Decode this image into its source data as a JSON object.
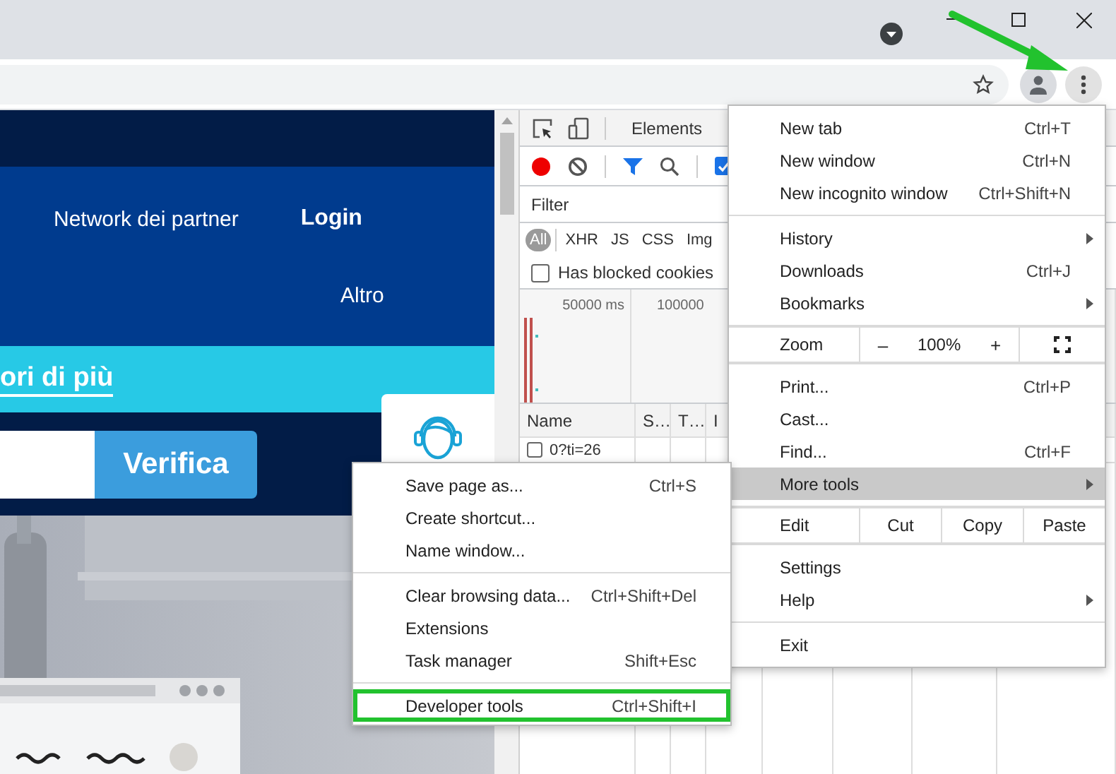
{
  "browser": {
    "menu_open": true
  },
  "page": {
    "nav": [
      {
        "label": "Network dei partner",
        "bold": false
      },
      {
        "label": "Login",
        "bold": true
      }
    ],
    "more_link": "Altro",
    "banner_link": "ori di più",
    "verify_button": "Verifica"
  },
  "devtools": {
    "tabs": [
      {
        "label": "Elements",
        "selected": false
      }
    ],
    "recording": true,
    "preserve_log": true,
    "filter": {
      "placeholder": "Filter"
    },
    "type_filters": [
      {
        "label": "All",
        "selected": true
      },
      {
        "label": "XHR",
        "selected": false
      },
      {
        "label": "JS",
        "selected": false
      },
      {
        "label": "CSS",
        "selected": false
      },
      {
        "label": "Img",
        "selected": false
      }
    ],
    "blocked_cookies": {
      "label": "Has blocked cookies",
      "checked": false
    },
    "timeline_ticks": [
      "50000 ms",
      "100000"
    ],
    "columns": [
      "Name",
      "S…",
      "T…",
      "I"
    ],
    "rows": [
      {
        "name": "0?ti=26",
        "checked": false
      }
    ]
  },
  "menu": [
    {
      "kind": "item",
      "label": "New tab",
      "shortcut": "Ctrl+T",
      "submenu": false,
      "highlighted": false
    },
    {
      "kind": "item",
      "label": "New window",
      "shortcut": "Ctrl+N",
      "submenu": false,
      "highlighted": false
    },
    {
      "kind": "item",
      "label": "New incognito window",
      "shortcut": "Ctrl+Shift+N",
      "submenu": false,
      "highlighted": false
    },
    {
      "kind": "separator"
    },
    {
      "kind": "item",
      "label": "History",
      "submenu": true,
      "highlighted": false
    },
    {
      "kind": "item",
      "label": "Downloads",
      "shortcut": "Ctrl+J",
      "submenu": false,
      "highlighted": false
    },
    {
      "kind": "item",
      "label": "Bookmarks",
      "submenu": true,
      "highlighted": false
    },
    {
      "kind": "separator"
    },
    {
      "kind": "zoom",
      "label": "Zoom",
      "minus": "–",
      "value": "100%",
      "plus": "+"
    },
    {
      "kind": "separator"
    },
    {
      "kind": "item",
      "label": "Print...",
      "shortcut": "Ctrl+P",
      "submenu": false,
      "highlighted": false
    },
    {
      "kind": "item",
      "label": "Cast...",
      "submenu": false,
      "highlighted": false
    },
    {
      "kind": "item",
      "label": "Find...",
      "shortcut": "Ctrl+F",
      "submenu": false,
      "highlighted": false
    },
    {
      "kind": "item",
      "label": "More tools",
      "submenu": true,
      "highlighted": true
    },
    {
      "kind": "separator"
    },
    {
      "kind": "edit",
      "label": "Edit",
      "buttons": [
        "Cut",
        "Copy",
        "Paste"
      ]
    },
    {
      "kind": "separator"
    },
    {
      "kind": "item",
      "label": "Settings",
      "submenu": false,
      "highlighted": false
    },
    {
      "kind": "item",
      "label": "Help",
      "submenu": true,
      "highlighted": false
    },
    {
      "kind": "separator"
    },
    {
      "kind": "item",
      "label": "Exit",
      "submenu": false,
      "highlighted": false
    }
  ],
  "submenu": [
    {
      "kind": "item",
      "label": "Save page as...",
      "shortcut": "Ctrl+S",
      "outlined": false
    },
    {
      "kind": "item",
      "label": "Create shortcut...",
      "outlined": false
    },
    {
      "kind": "item",
      "label": "Name window...",
      "outlined": false
    },
    {
      "kind": "separator"
    },
    {
      "kind": "item",
      "label": "Clear browsing data...",
      "shortcut": "Ctrl+Shift+Del",
      "outlined": false
    },
    {
      "kind": "item",
      "label": "Extensions",
      "outlined": false
    },
    {
      "kind": "item",
      "label": "Task manager",
      "shortcut": "Shift+Esc",
      "outlined": false
    },
    {
      "kind": "separator"
    },
    {
      "kind": "item",
      "label": "Developer tools",
      "shortcut": "Ctrl+Shift+I",
      "outlined": true
    }
  ]
}
